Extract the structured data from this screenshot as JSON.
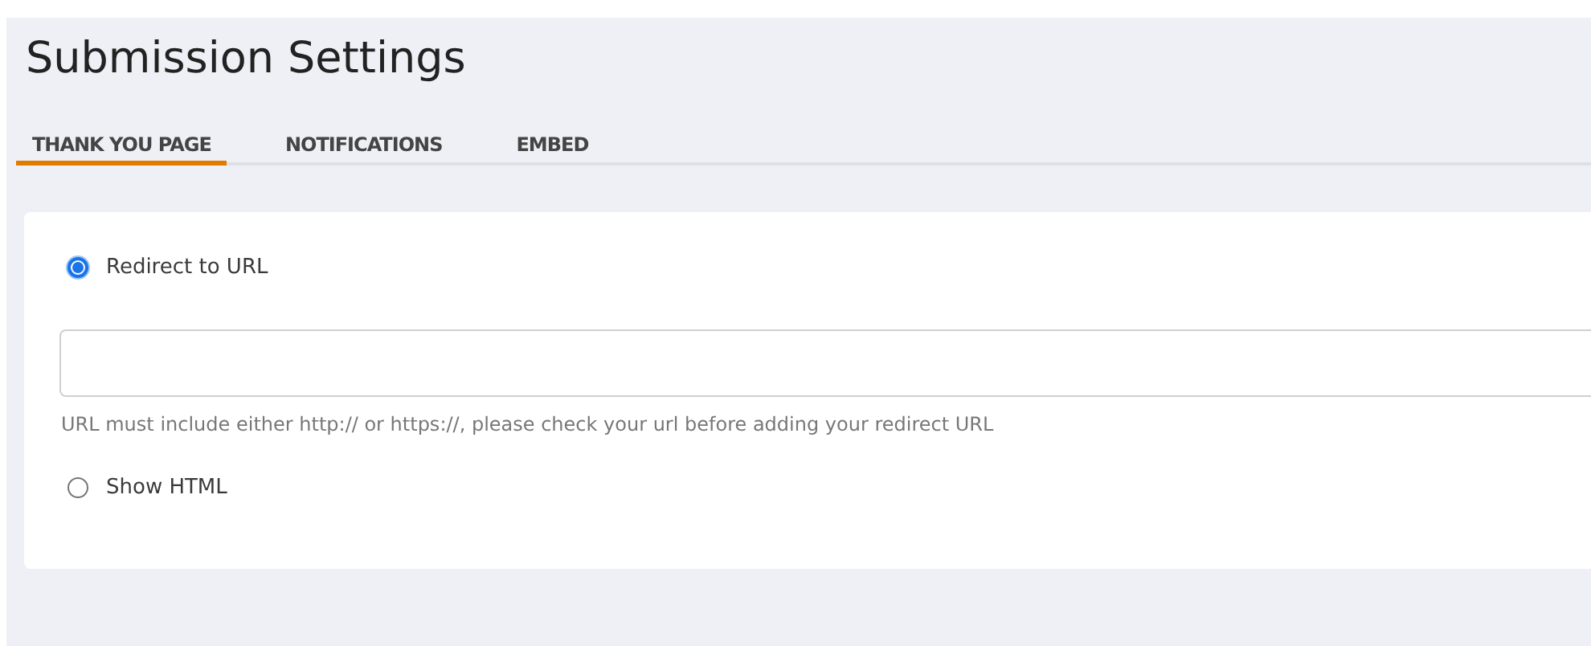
{
  "title": "Submission Settings",
  "tabs": [
    {
      "label": "THANK YOU PAGE",
      "selected": true
    },
    {
      "label": "NOTIFICATIONS",
      "selected": false
    },
    {
      "label": "EMBED",
      "selected": false
    }
  ],
  "options": [
    {
      "label": "Redirect to URL",
      "selected": true
    },
    {
      "label": "Show HTML",
      "selected": false
    }
  ],
  "url_field": {
    "hint": "URL must include either http:// or https://, please check your url before adding your redirect URL"
  }
}
